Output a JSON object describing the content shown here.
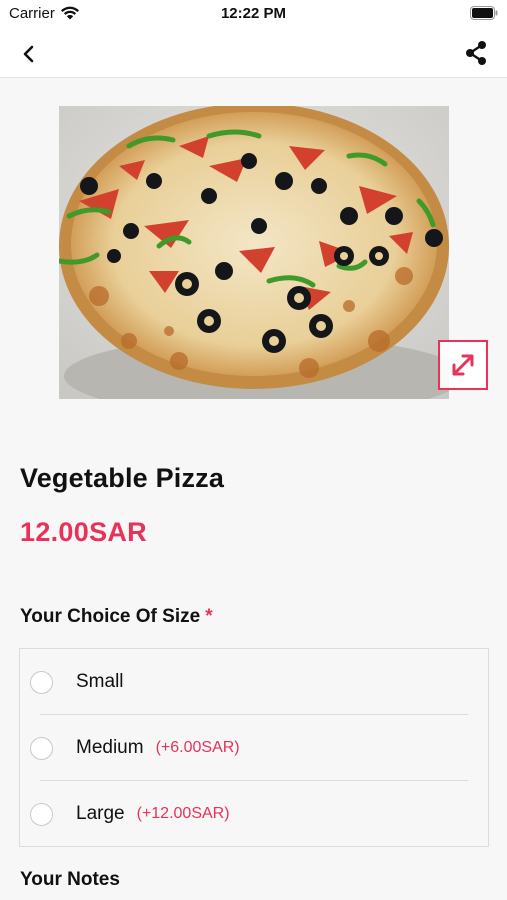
{
  "status_bar": {
    "carrier": "Carrier",
    "time": "12:22 PM"
  },
  "nav": {
    "back_icon": "chevron-left-icon",
    "share_icon": "share-icon"
  },
  "product": {
    "name": "Vegetable Pizza",
    "price": "12.00SAR",
    "image_alt": "pizza-photo"
  },
  "size_section": {
    "heading": "Your Choice Of Size",
    "required_mark": "*",
    "options": [
      {
        "label": "Small",
        "extra": ""
      },
      {
        "label": "Medium",
        "extra": "(+6.00SAR)"
      },
      {
        "label": "Large",
        "extra": "(+12.00SAR)"
      }
    ]
  },
  "notes_section": {
    "heading": "Your Notes"
  },
  "colors": {
    "accent": "#e8325a",
    "background": "#f7f7f7"
  }
}
